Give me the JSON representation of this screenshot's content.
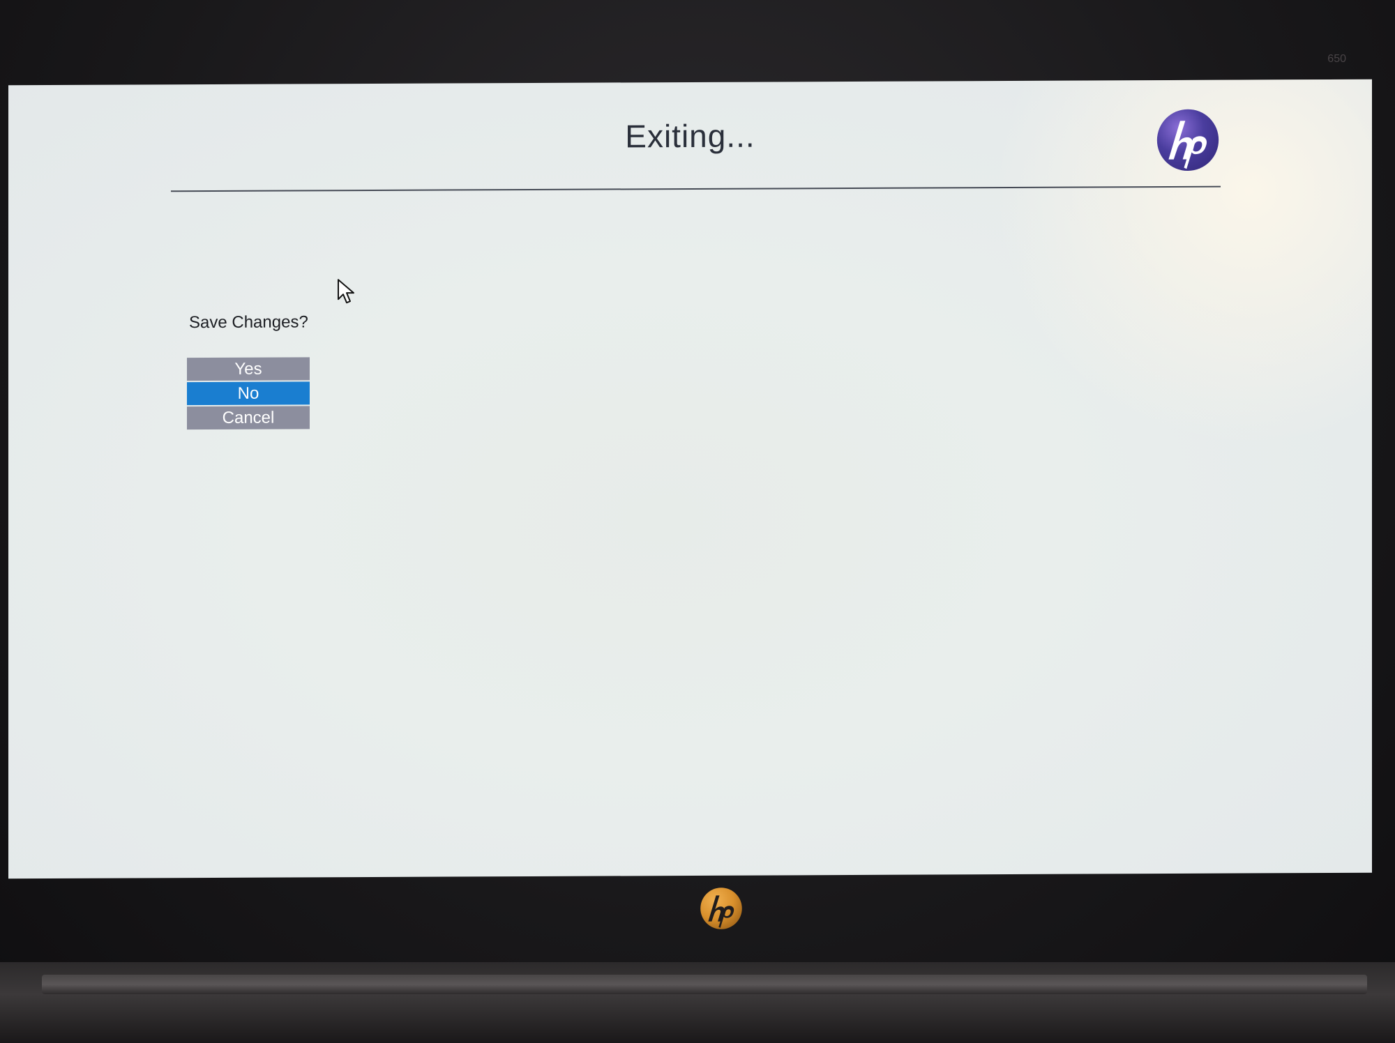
{
  "bezel": {
    "model_text": "650"
  },
  "screen": {
    "title": "Exiting...",
    "logo_icon": "hp-logo-icon",
    "prompt": "Save Changes?",
    "buttons": [
      {
        "label": "Yes",
        "selected": false
      },
      {
        "label": "No",
        "selected": true
      },
      {
        "label": "Cancel",
        "selected": false
      }
    ]
  },
  "colors": {
    "selected_button": "#1a7ed0",
    "unselected_button": "#8c8e9e",
    "hp_logo_screen": "#4a3d9e",
    "hp_logo_bezel": "#d9902c"
  }
}
